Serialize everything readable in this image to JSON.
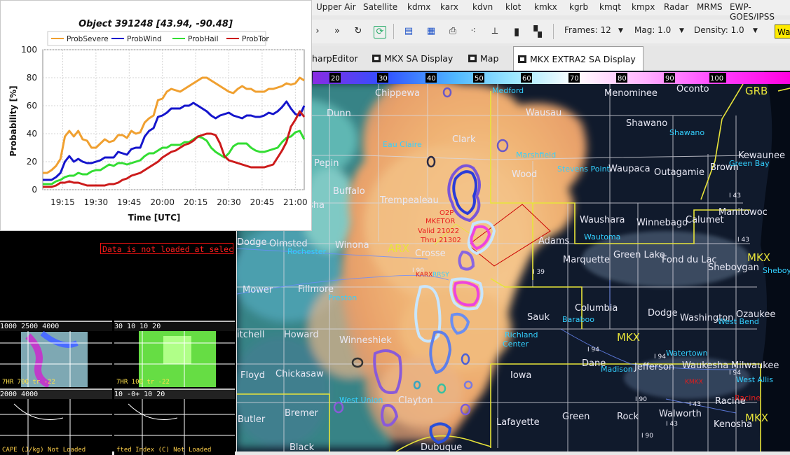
{
  "menu": [
    "Upper Air",
    "Satellite",
    "kdmx",
    "karx",
    "kdvn",
    "klot",
    "kmkx",
    "kgrb",
    "kmqt",
    "kmpx",
    "Radar",
    "MRMS",
    "EWP-GOES/JPSS"
  ],
  "toolbar": {
    "frames_label": "Frames: 12",
    "mag_label": "Mag: 1.0",
    "density_label": "Density: 1.0",
    "warn_label": "Wa"
  },
  "tabs": [
    {
      "label": "harpEditor"
    },
    {
      "label": "MKX SA Display"
    },
    {
      "label": "Map"
    },
    {
      "label": "MKX EXTRA2 SA Display",
      "close": "⊠"
    }
  ],
  "colorbar": {
    "ticks": [
      "20",
      "30",
      "40",
      "50",
      "60",
      "70",
      "80",
      "90",
      "100"
    ]
  },
  "map_labels": {
    "chippewa": "Chippewa",
    "medford": "Medford",
    "menominee": "Menominee",
    "oconto": "Oconto",
    "grb": "GRB",
    "dunn": "Dunn",
    "wausau": "Wausau",
    "shawano": "Shawano",
    "shawano_city": "Shawano",
    "clark": "Clark",
    "eau_claire": "Eau Claire",
    "marshfield": "Marshfield",
    "kewaunee": "Kewaunee",
    "wood": "Wood",
    "stevens_point": "Stevens Point",
    "waupaca": "Waupaca",
    "outagamie": "Outagamie",
    "brown": "Brown",
    "green_bay": "Green Bay",
    "pepin": "Pepin",
    "buffalo": "Buffalo",
    "trempealeau": "Trempealeau",
    "manitowoc": "Manitowoc",
    "waushara": "Waushara",
    "wautoma": "Wautoma",
    "winnebago": "Winnebago",
    "calumet": "Calumet",
    "adams": "Adams",
    "sha": "sha",
    "dodge_mn": "Dodge",
    "olmsted": "Olmsted",
    "rochester": "Rochester",
    "winona": "Winona",
    "arx": "ARX",
    "la_crosse": "Crosse",
    "marquette": "Marquette",
    "green_lake": "Green Lake",
    "fond_du_lac": "Fond du Lac",
    "sheboygan": "Sheboygan",
    "sheboy": "Sheboy",
    "mkx_r": "MKX",
    "mower": "Mower",
    "fillmore": "Fillmore",
    "preston": "Preston",
    "sauk": "Sauk",
    "baraboo": "Baraboo",
    "columbia": "Columbia",
    "dodge_wi": "Dodge",
    "washington": "Washington",
    "ozaukee": "Ozaukee",
    "west_bend": "West Bend",
    "mitchell": "itchell",
    "howard": "Howard",
    "winneshiek": "Winneshiek",
    "richland": "Richland",
    "richland_center": "Center",
    "mkx_c": "MKX",
    "watertown": "Watertown",
    "dane": "Dane",
    "madison": "Madison",
    "jefferson": "Jefferson",
    "waukesha": "Waukesha",
    "milwaukee": "Milwaukee",
    "west_allis": "West Allis",
    "kmkx": "KMKX",
    "floyd": "Floyd",
    "chickasaw": "Chickasaw",
    "iowa": "Iowa",
    "west_union": "West Union",
    "clayton": "Clayton",
    "racine": "Racine",
    "bremer": "Bremer",
    "lafayette": "Lafayette",
    "green": "Green",
    "rock": "Rock",
    "walworth": "Walworth",
    "kenosha": "Kenosha",
    "mkx_b": "MKX",
    "butler": "Butler",
    "black_hawk": "Black",
    "dubuque": "Dubuque",
    "racine_city": "Racine",
    "i94a": "I 94",
    "i94b": "I 94",
    "i94c": "I 94",
    "i43a": "I 43",
    "i43b": "I 43",
    "i43c": "I 43",
    "i43d": "I 43",
    "i90a": "I 90",
    "i90b": "I 90",
    "i39": "I 39",
    "i90c": "I 90",
    "mketor_l1": "MKETOR",
    "mketor_l2": "Valid 21022",
    "mketor_l3": "Thru 21302",
    "mketor_id": "O2P",
    "karx": "KARX",
    "rrsy": "RRSY"
  },
  "left_panel": {
    "no_data_msg": "Data is not loaded at selected time"
  },
  "thumbs": [
    {
      "bar": "1000 2500 4000",
      "cap": "7HR 700 tr -22"
    },
    {
      "bar": "30 10  10 20",
      "cap": "7HR 100 tr -22"
    },
    {
      "bar": " 2000 4000",
      "cap": "CAPE (J/kg) Not Loaded"
    },
    {
      "bar": "10 -0+ 10  20",
      "cap": "fted Index (C) Not Loaded"
    }
  ],
  "chart_data": {
    "type": "line",
    "title": "Object 391248 [43.94, -90.48]",
    "xlabel": "Time [UTC]",
    "ylabel": "Probability [%]",
    "x_ticks": [
      "19:15",
      "19:30",
      "19:45",
      "20:00",
      "20:15",
      "20:30",
      "20:45",
      "21:00"
    ],
    "x_tick_minutes": [
      15,
      30,
      45,
      60,
      75,
      90,
      105,
      120
    ],
    "x_range_minutes": [
      6,
      124
    ],
    "ylim": [
      0,
      100
    ],
    "y_ticks": [
      0,
      20,
      40,
      60,
      80,
      100
    ],
    "grid": true,
    "legend_position": "top",
    "x_minutes": [
      6,
      8,
      10,
      12,
      14,
      16,
      18,
      20,
      22,
      24,
      26,
      28,
      30,
      32,
      34,
      36,
      38,
      40,
      42,
      44,
      46,
      48,
      50,
      52,
      54,
      56,
      58,
      60,
      62,
      64,
      66,
      68,
      70,
      72,
      74,
      76,
      78,
      80,
      82,
      84,
      86,
      88,
      90,
      92,
      94,
      96,
      98,
      100,
      102,
      104,
      106,
      108,
      110,
      112,
      114,
      116,
      118,
      120,
      122,
      124
    ],
    "series": [
      {
        "name": "ProbSevere",
        "color": "#f0a030",
        "values": [
          12,
          12,
          14,
          17,
          22,
          38,
          42,
          38,
          42,
          36,
          35,
          30,
          30,
          33,
          36,
          34,
          35,
          39,
          39,
          37,
          42,
          40,
          41,
          48,
          51,
          53,
          64,
          65,
          70,
          72,
          71,
          70,
          72,
          74,
          76,
          78,
          80,
          80,
          78,
          76,
          74,
          72,
          70,
          69,
          72,
          74,
          72,
          72,
          70,
          70,
          70,
          72,
          72,
          73,
          74,
          76,
          75,
          76,
          80,
          78
        ]
      },
      {
        "name": "ProbWind",
        "color": "#1515cc",
        "values": [
          7,
          7,
          7,
          9,
          12,
          20,
          24,
          20,
          22,
          20,
          19,
          19,
          20,
          21,
          23,
          23,
          23,
          27,
          26,
          25,
          29,
          30,
          30,
          38,
          42,
          44,
          52,
          53,
          55,
          58,
          58,
          58,
          60,
          60,
          62,
          60,
          58,
          56,
          53,
          51,
          53,
          54,
          55,
          53,
          52,
          51,
          53,
          53,
          52,
          52,
          53,
          55,
          54,
          56,
          59,
          63,
          58,
          54,
          53,
          60
        ]
      },
      {
        "name": "ProbHail",
        "color": "#33dd33",
        "values": [
          4,
          4,
          4,
          6,
          7,
          9,
          10,
          10,
          12,
          11,
          11,
          13,
          14,
          14,
          16,
          18,
          17,
          19,
          19,
          18,
          19,
          20,
          21,
          24,
          26,
          26,
          28,
          30,
          30,
          32,
          32,
          32,
          34,
          34,
          36,
          38,
          37,
          35,
          30,
          27,
          25,
          23,
          26,
          31,
          33,
          33,
          33,
          30,
          28,
          27,
          27,
          28,
          29,
          30,
          34,
          37,
          38,
          41,
          42,
          36
        ]
      },
      {
        "name": "ProbTor",
        "color": "#cc1b1b",
        "values": [
          2,
          2,
          2,
          3,
          5,
          5,
          6,
          5,
          5,
          4,
          3,
          3,
          3,
          3,
          3,
          4,
          4,
          5,
          7,
          8,
          10,
          11,
          12,
          14,
          16,
          18,
          20,
          23,
          25,
          27,
          28,
          30,
          32,
          33,
          35,
          38,
          39,
          40,
          40,
          39,
          33,
          24,
          21,
          20,
          19,
          18,
          17,
          16,
          16,
          16,
          16,
          17,
          18,
          23,
          28,
          34,
          45,
          50,
          56,
          52
        ]
      }
    ]
  }
}
